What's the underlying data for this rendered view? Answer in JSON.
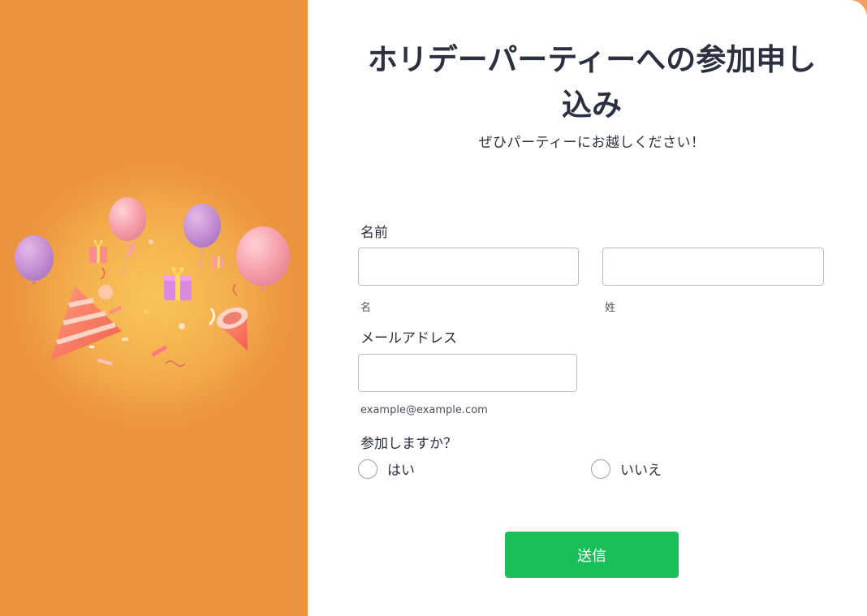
{
  "left": {
    "illustration": "party-celebration-illustration"
  },
  "form": {
    "title": "ホリデーパーティーへの参加申し込み",
    "subtitle": "ぜひパーティーにお越しください！",
    "name_label": "名前",
    "first_name": {
      "value": "",
      "hint": "名"
    },
    "last_name": {
      "value": "",
      "hint": "姓"
    },
    "email_label": "メールアドレス",
    "email": {
      "value": "",
      "hint": "example@example.com"
    },
    "attend_label": "参加しますか？",
    "options": [
      {
        "label": "はい",
        "selected": false
      },
      {
        "label": "いいえ",
        "selected": false
      }
    ],
    "submit_label": "送信"
  },
  "colors": {
    "left_panel": "#ec9340",
    "submit": "#1abf5a",
    "text": "#2b3040"
  }
}
